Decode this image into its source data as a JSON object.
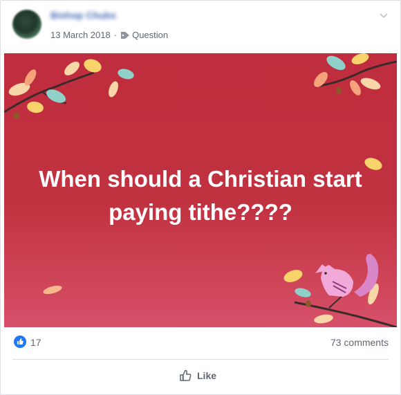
{
  "post": {
    "author_name": "Bishop Chubs",
    "date": "13 March 2018",
    "separator": "·",
    "category": "Question",
    "banner_text": "When should a Christian start paying tithe????",
    "banner_color": "#c13240"
  },
  "reactions": {
    "like_count": "17",
    "comments_label": "73 comments",
    "like_badge_color": "#2078f4"
  },
  "actions": {
    "like_label": "Like"
  },
  "icons": {
    "options": "chevron-down-icon",
    "category": "tag-icon",
    "like_badge": "thumbs-up-icon",
    "like_action": "thumbs-up-outline-icon"
  }
}
